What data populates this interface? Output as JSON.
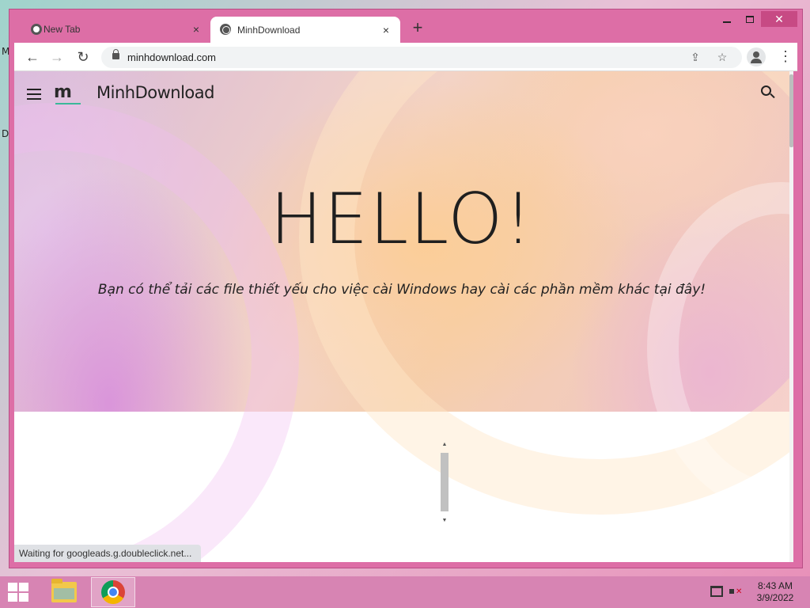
{
  "desktop": {
    "edge_glyphs": [
      "M",
      "D"
    ]
  },
  "browser": {
    "tabs": [
      {
        "label": "New Tab",
        "active": false,
        "icon": "chrome-icon"
      },
      {
        "label": "MinhDownload",
        "active": true,
        "icon": "globe-icon"
      }
    ],
    "tab_close_glyph": "×",
    "new_tab_glyph": "+",
    "window_close_glyph": "✕",
    "url": "minhdownload.com",
    "status_text": "Waiting for googleads.g.doubleclick.net..."
  },
  "page": {
    "site_name": "MinhDownload",
    "logo_letter": "m",
    "hero_title": "HELLO!",
    "hero_subtitle": "Bạn có thể tải các file thiết yếu cho việc cài Windows hay cài các phần mềm khác tại đây!"
  },
  "taskbar": {
    "apps": [
      "file-explorer",
      "google-chrome"
    ],
    "clock_time": "8:43 AM",
    "clock_date": "3/9/2022"
  },
  "colors": {
    "window_frame": "#dd6ea6",
    "taskbar": "#d784b3",
    "close_button": "#c74a84",
    "logo_underline": "#3bb89a"
  }
}
